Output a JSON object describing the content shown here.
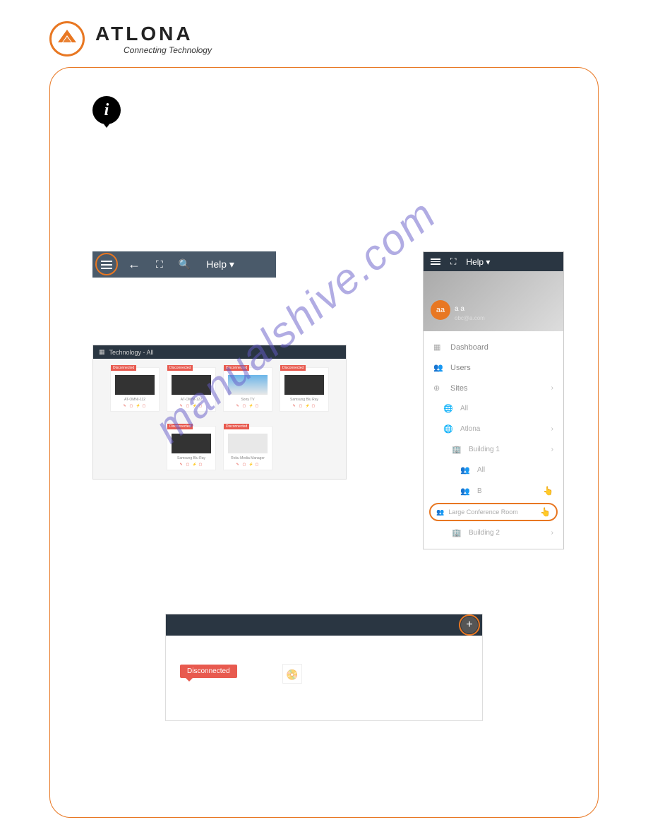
{
  "logo": {
    "brand": "ATLONA",
    "tagline": "Connecting Technology"
  },
  "toolbar": {
    "help_label": "Help ▾"
  },
  "dashboard": {
    "title": "Technology - All",
    "devices": [
      {
        "name": "AT-OMNI-112",
        "tag": "Disconnected"
      },
      {
        "name": "AT-OMNI-122",
        "tag": "Disconnected"
      },
      {
        "name": "Sony TV",
        "tag": "Disconnected"
      },
      {
        "name": "Samsung Blu Ray",
        "tag": "Disconnected"
      },
      {
        "name": "Samsung Blu Ray",
        "tag": "Disconnected"
      },
      {
        "name": "Roku Media Manager",
        "tag": "Disconnected"
      }
    ]
  },
  "sidebar": {
    "top_help": "Help ▾",
    "user_initials": "aa",
    "user_name": "a a",
    "user_email": "obc@a.com",
    "items": {
      "dashboard": "Dashboard",
      "users": "Users",
      "sites": "Sites",
      "all": "All",
      "atlona": "Atlona",
      "building1": "Building 1",
      "building1_all": "All",
      "building1_b": "B",
      "large_conf": "Large Conference Room",
      "building2": "Building 2"
    }
  },
  "room": {
    "disconnected": "Disconnected"
  },
  "watermark": "manualshive.com"
}
